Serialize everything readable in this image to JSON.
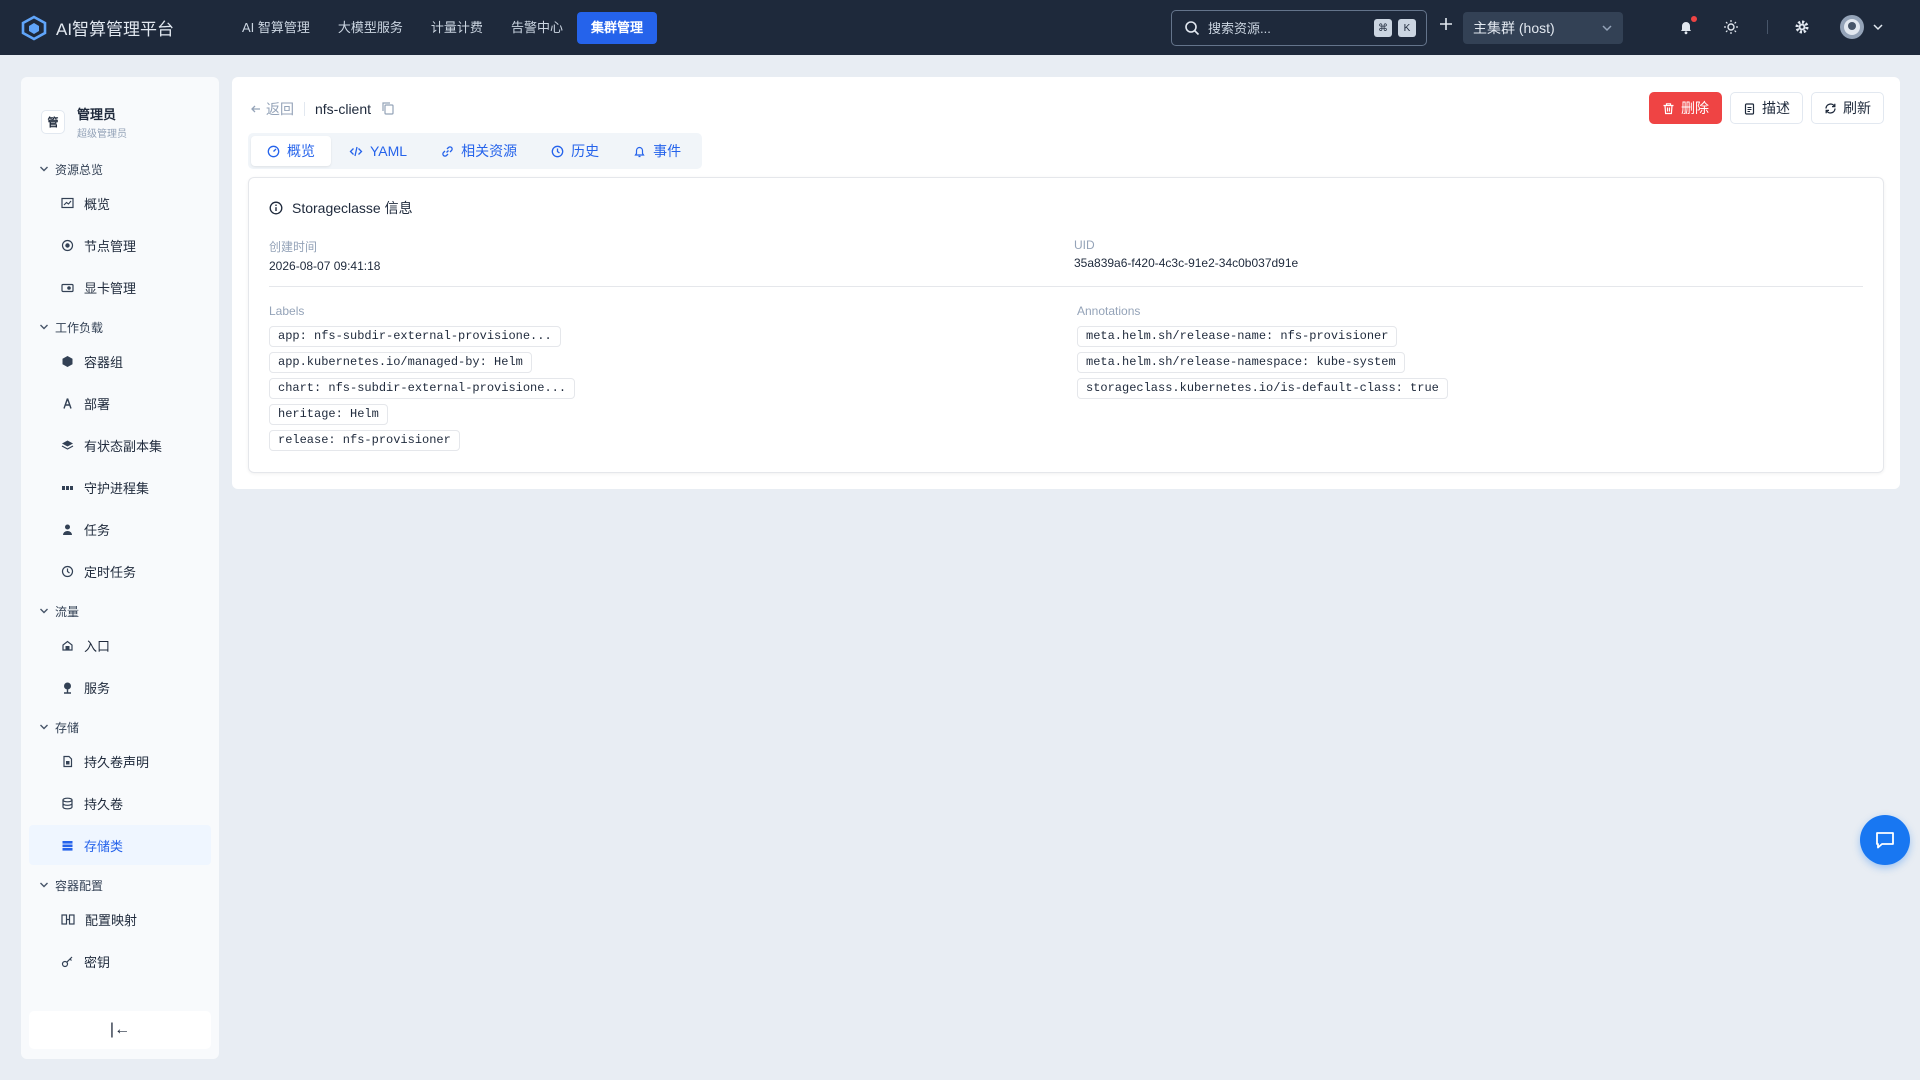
{
  "app": {
    "title": "AI智算管理平台",
    "brand_color": "#2563eb"
  },
  "nav": [
    {
      "label": "AI 智算管理",
      "active": false
    },
    {
      "label": "大模型服务",
      "active": false
    },
    {
      "label": "计量计费",
      "active": false
    },
    {
      "label": "告警中心",
      "active": false
    },
    {
      "label": "集群管理",
      "active": true
    }
  ],
  "search": {
    "placeholder": "搜索资源...",
    "shortcut_mod": "⌘",
    "shortcut_key": "K"
  },
  "cluster": {
    "selected": "主集群 (host)"
  },
  "user": {
    "name": "管理员",
    "role": "超级管理员",
    "initial": "管"
  },
  "sidebar": {
    "sections": [
      {
        "title": "资源总览",
        "items": [
          {
            "label": "概览",
            "icon": "dashboard-icon"
          },
          {
            "label": "节点管理",
            "icon": "node-icon"
          },
          {
            "label": "显卡管理",
            "icon": "gpu-icon"
          }
        ]
      },
      {
        "title": "工作负载",
        "items": [
          {
            "label": "容器组",
            "icon": "pod-icon"
          },
          {
            "label": "部署",
            "icon": "deploy-icon"
          },
          {
            "label": "有状态副本集",
            "icon": "layers-icon"
          },
          {
            "label": "守护进程集",
            "icon": "daemon-icon"
          },
          {
            "label": "任务",
            "icon": "job-icon"
          },
          {
            "label": "定时任务",
            "icon": "clock-icon"
          }
        ]
      },
      {
        "title": "流量",
        "items": [
          {
            "label": "入口",
            "icon": "ingress-icon"
          },
          {
            "label": "服务",
            "icon": "service-icon"
          }
        ]
      },
      {
        "title": "存储",
        "items": [
          {
            "label": "持久卷声明",
            "icon": "pvc-icon"
          },
          {
            "label": "持久卷",
            "icon": "database-icon"
          },
          {
            "label": "存储类",
            "icon": "storage-icon",
            "active": true
          }
        ]
      },
      {
        "title": "容器配置",
        "items": [
          {
            "label": "配置映射",
            "icon": "configmap-icon"
          },
          {
            "label": "密钥",
            "icon": "key-icon"
          }
        ]
      }
    ],
    "collapse_glyph": "|←"
  },
  "detail": {
    "back_label": "返回",
    "resource_name": "nfs-client",
    "actions": {
      "delete": "删除",
      "describe": "描述",
      "refresh": "刷新"
    },
    "tabs": [
      {
        "label": "概览",
        "active": true
      },
      {
        "label": "YAML"
      },
      {
        "label": "相关资源"
      },
      {
        "label": "历史"
      },
      {
        "label": "事件"
      }
    ],
    "card_title": "Storageclasse 信息",
    "created_label": "创建时间",
    "created_value": "2026-08-07 09:41:18",
    "uid_label": "UID",
    "uid_value": "35a839a6-f420-4c3c-91e2-34c0b037d91e",
    "labels_title": "Labels",
    "labels": [
      "app: nfs-subdir-external-provisione...",
      "app.kubernetes.io/managed-by: Helm",
      "chart: nfs-subdir-external-provisione...",
      "heritage: Helm",
      "release: nfs-provisioner"
    ],
    "annotations_title": "Annotations",
    "annotations": [
      "meta.helm.sh/release-name: nfs-provisioner",
      "meta.helm.sh/release-namespace: kube-system",
      "storageclass.kubernetes.io/is-default-class: true"
    ]
  }
}
